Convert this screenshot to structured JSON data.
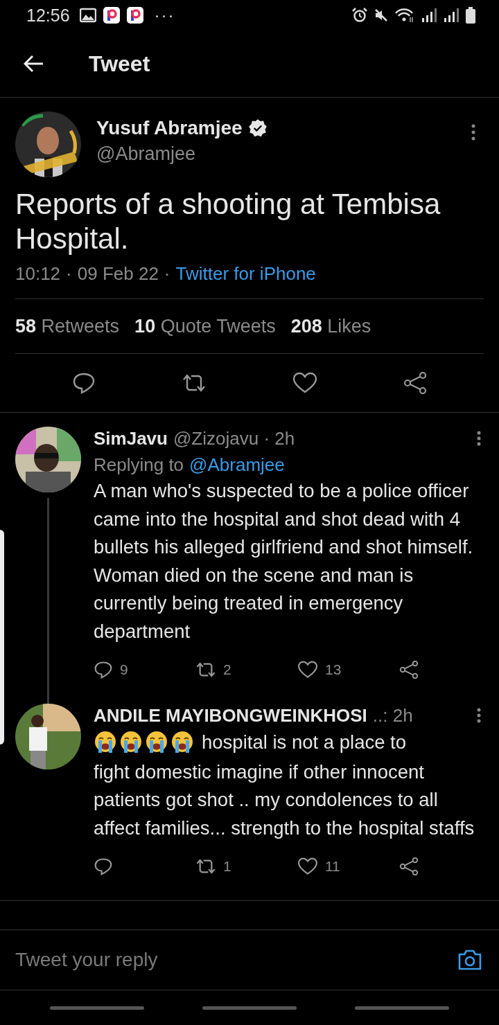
{
  "status_bar": {
    "time": "12:56",
    "overflow": "···"
  },
  "header": {
    "title": "Tweet"
  },
  "tweet": {
    "author": {
      "name": "Yusuf Abramjee",
      "handle": "@Abramjee",
      "verified": true
    },
    "text": "Reports of a shooting at Tembisa Hospital.",
    "time": "10:12",
    "separator": "·",
    "date": "09 Feb 22",
    "separator_2": "·",
    "source": "Twitter for iPhone",
    "stats": [
      {
        "count": "58",
        "label": "Retweets"
      },
      {
        "count": "10",
        "label": "Quote Tweets"
      },
      {
        "count": "208",
        "label": "Likes"
      }
    ]
  },
  "replies": [
    {
      "name": "SimJavu",
      "byline": "@Zizojavu · 2h",
      "replying_label": "Replying to",
      "replying_handle": "@Abramjee",
      "text": "A man who's suspected to be a police officer came into the hospital and shot dead with 4 bullets his alleged girlfriend and shot himself. Woman died on the scene and man is currently being treated in emergency department",
      "counts": {
        "replies": "9",
        "retweets": "2",
        "likes": "13"
      }
    },
    {
      "name": "ANDILE MAYIBONGWEINKHOSI",
      "byline": "..: 2h",
      "reactions": [
        {
          "kind": "crying"
        },
        {
          "kind": "crying"
        },
        {
          "kind": "crying"
        },
        {
          "kind": "crying"
        }
      ],
      "lead_text": "hospital is not a place to",
      "text": "fight domestic imagine if other innocent patients got shot .. my condolences to all affect families... strength to the hospital staffs",
      "counts": {
        "retweets": "1",
        "likes": "11"
      }
    }
  ],
  "reply_bar": {
    "placeholder": "Tweet your reply"
  }
}
